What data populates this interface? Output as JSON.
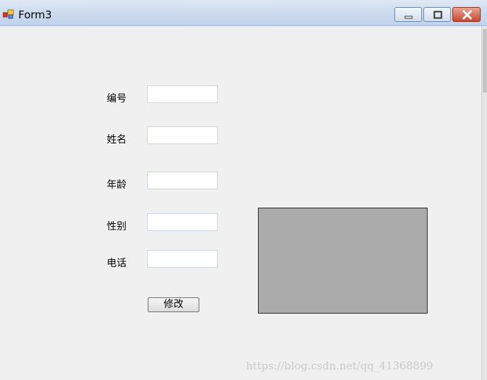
{
  "window": {
    "title": "Form3",
    "icon": "winforms-app-icon"
  },
  "controls": {
    "minimize_icon": "minimize-icon",
    "maximize_icon": "maximize-icon",
    "close_icon": "close-icon"
  },
  "form": {
    "fields": [
      {
        "label": "编号",
        "value": ""
      },
      {
        "label": "姓名",
        "value": ""
      },
      {
        "label": "年龄",
        "value": ""
      },
      {
        "label": "性别",
        "value": ""
      },
      {
        "label": "电话",
        "value": ""
      }
    ],
    "submit_label": "修改"
  },
  "picture_box": {
    "fill": "#ababab"
  },
  "watermark": "https://blog.csdn.net/qq_41368899"
}
